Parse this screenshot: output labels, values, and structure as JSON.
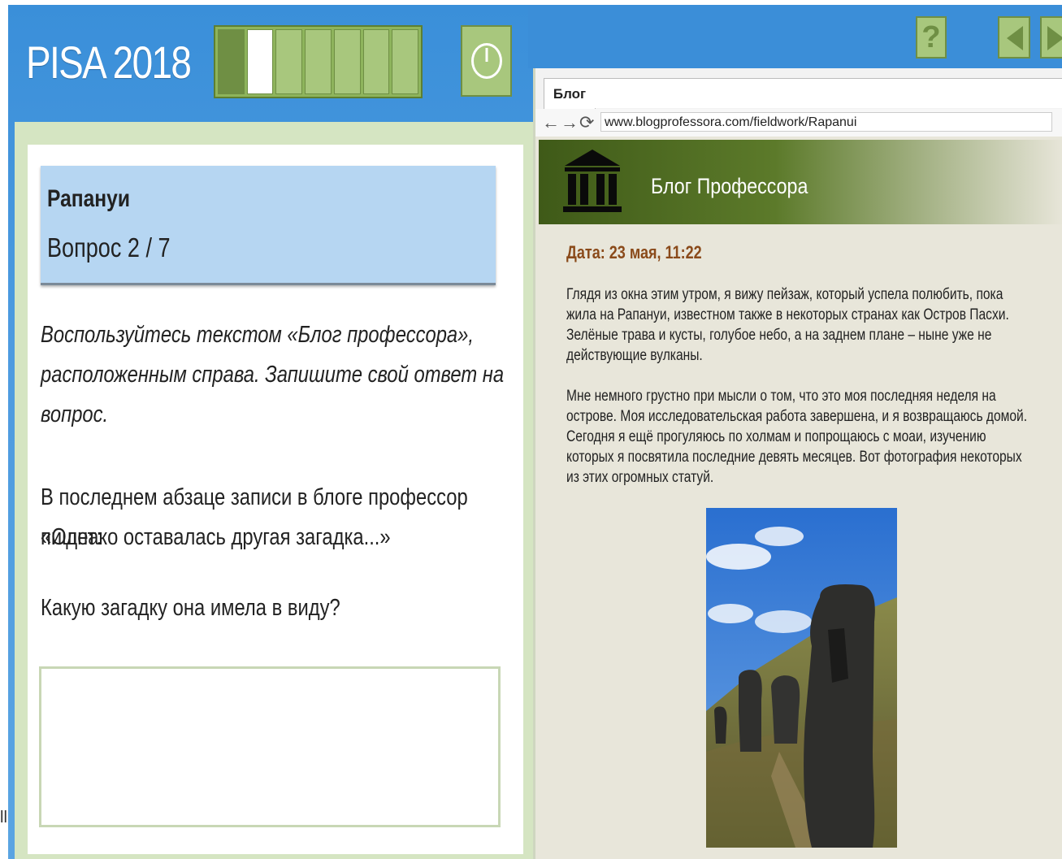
{
  "header": {
    "brand": "PISA 2018",
    "progress": {
      "total_segments": 7,
      "completed": 1,
      "current": 2
    }
  },
  "question": {
    "title": "Рапануи",
    "number": "Вопрос 2 / 7",
    "instruction_lines": [
      "Воспользуйтесь текстом «Блог профессора»,",
      "расположенным справа. Запишите свой ответ на",
      "вопрос."
    ],
    "quote_lines": [
      "В последнем абзаце записи в блоге профессор пишет:",
      "«Однако оставалась другая загадка...»"
    ],
    "prompt": "Какую загадку она имела в виду?",
    "answer_value": ""
  },
  "edge_mark": "ll",
  "browser": {
    "tab_label": "Блог",
    "url": "www.blogprofessora.com/fieldwork/Rapanui",
    "blog_title": "Блог Профессора",
    "post_date": "Дата: 23 мая, 11:22",
    "paragraph1_lines": [
      "Глядя из окна этим утром, я вижу пейзаж, который успела полюбить, пока",
      "жила на Рапануи, известном также в некоторых странах как Остров Пасхи.",
      "Зелёные трава и кусты, голубое небо, а на заднем плане – ныне уже не",
      "действующие вулканы."
    ],
    "paragraph2_lines": [
      "Мне немного грустно при мысли о том, что это моя последняя неделя на",
      "острове. Моя исследовательская работа завершена, и я возвращаюсь домой.",
      "Сегодня я ещё прогуляюсь по холмам и попрощаюсь с моаи, изучению",
      "которых я посвятила последние девять месяцев. Вот фотография некоторых",
      "из этих огромных статуй."
    ]
  },
  "colors": {
    "frame_blue": "#3a8fd9",
    "progress_green": "#8eb45c",
    "card_blue": "#b6d6f2",
    "date_brown": "#8a4a1a",
    "blog_header_green": "#3f5a18"
  },
  "icons": [
    "timer-icon",
    "help-icon",
    "prev-arrow-icon",
    "next-arrow-icon",
    "back-arrow-icon",
    "forward-arrow-icon",
    "reload-icon",
    "temple-icon"
  ]
}
